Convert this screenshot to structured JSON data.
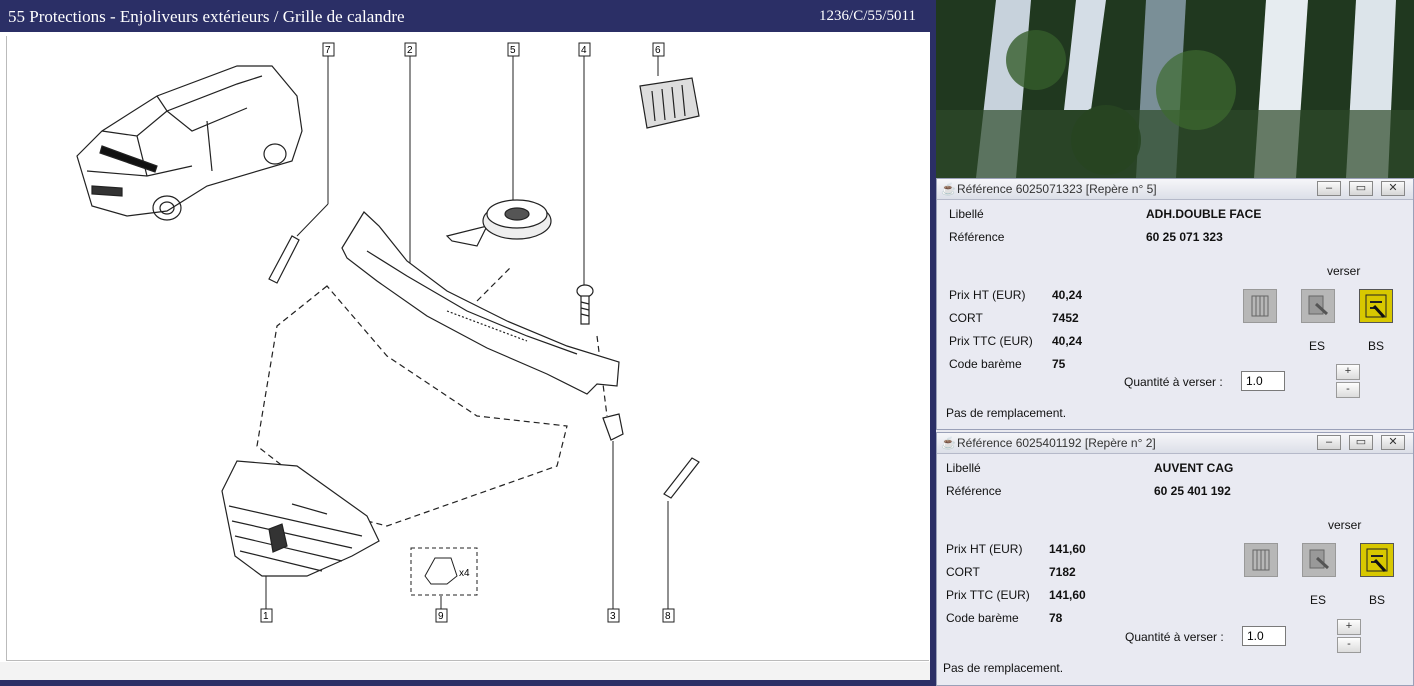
{
  "catalog": {
    "title": "55 Protections - Enjoliveurs extérieurs / Grille de calandre",
    "code": "1236/C/55/5011",
    "callouts": [
      "7",
      "2",
      "5",
      "4",
      "6",
      "1",
      "9",
      "3",
      "8"
    ],
    "qty_note": "x4"
  },
  "windows": [
    {
      "title": "Référence 6025071323 [Repère n° 5]",
      "libelle_label": "Libellé",
      "libelle_value": "ADH.DOUBLE FACE",
      "reference_label": "Référence",
      "reference_value": "60 25 071 323",
      "verser_label": "verser",
      "prix_ht_label": "Prix HT (EUR)",
      "prix_ht_value": "40,24",
      "cort_label": "CORT",
      "cort_value": "7452",
      "prix_ttc_label": "Prix TTC (EUR)",
      "prix_ttc_value": "40,24",
      "code_label": "Code barème",
      "code_value": "75",
      "es_label": "ES",
      "bs_label": "BS",
      "qty_label": "Quantité à verser :",
      "qty_value": "1.0",
      "footer": "Pas de remplacement."
    },
    {
      "title": "Référence 6025401192 [Repère n° 2]",
      "libelle_label": "Libellé",
      "libelle_value": "AUVENT CAG",
      "reference_label": "Référence",
      "reference_value": "60 25 401 192",
      "verser_label": "verser",
      "prix_ht_label": "Prix HT (EUR)",
      "prix_ht_value": "141,60",
      "cort_label": "CORT",
      "cort_value": "7182",
      "prix_ttc_label": "Prix TTC (EUR)",
      "prix_ttc_value": "141,60",
      "code_label": "Code barème",
      "code_value": "78",
      "es_label": "ES",
      "bs_label": "BS",
      "qty_label": "Quantité à verser :",
      "qty_value": "1.0",
      "footer": "Pas de remplacement."
    }
  ],
  "controls": {
    "minimize": "–",
    "maximize": "▭",
    "close": "✕",
    "plus": "+",
    "minus": "-",
    "java_icon": "☕"
  },
  "icons": [
    "java-cup-icon",
    "minimize-icon",
    "maximize-icon",
    "close-icon",
    "catalog-icon",
    "calculator-icon",
    "cart-icon"
  ]
}
